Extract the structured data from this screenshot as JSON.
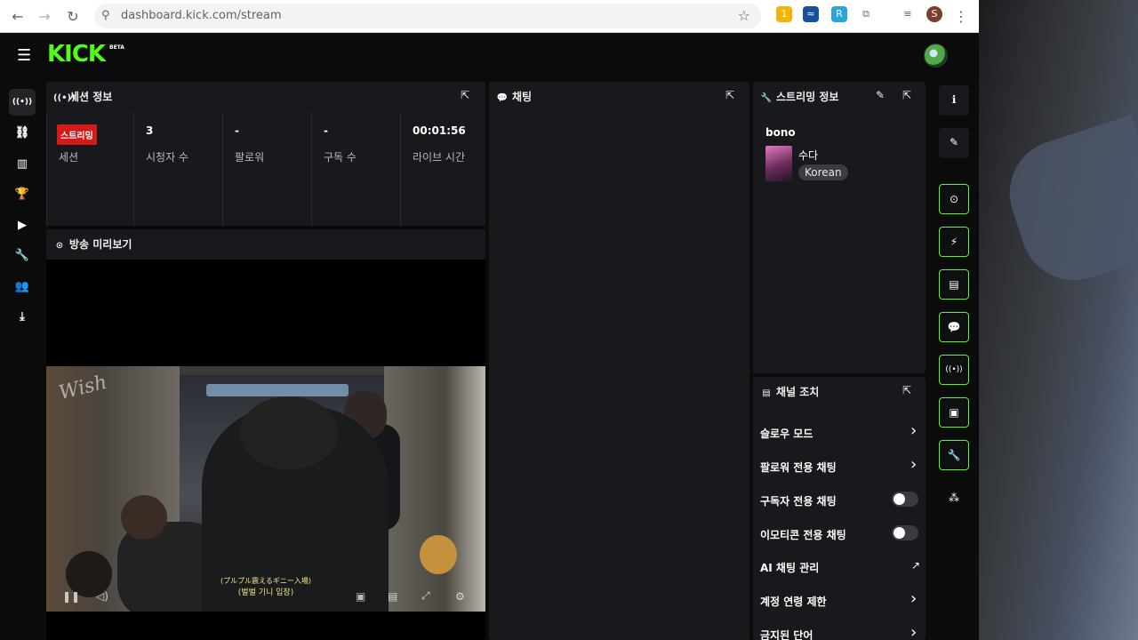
{
  "browser": {
    "url": "dashboard.kick.com/stream",
    "nav_back": "←",
    "nav_forward": "→",
    "reload": "↻",
    "site_icon": "⚲",
    "star": "☆",
    "menu": "⋮",
    "extensions": [
      "1",
      "≈",
      "R",
      "⧉",
      "≡"
    ],
    "profile_initial": "S"
  },
  "app": {
    "logo": "KICK",
    "logo_badge": "BETA",
    "menu_icon": "☰",
    "left_nav": [
      {
        "icon": "((•))",
        "name": "stream"
      },
      {
        "icon": "⛓",
        "name": "links"
      },
      {
        "icon": "▥",
        "name": "analytics"
      },
      {
        "icon": "🏆",
        "name": "achievements"
      },
      {
        "icon": "▶",
        "name": "videos"
      },
      {
        "icon": "🔧",
        "name": "tools"
      },
      {
        "icon": "👥",
        "name": "community"
      },
      {
        "icon": "⤓",
        "name": "upload"
      }
    ]
  },
  "session": {
    "title": "세션 정보",
    "title_icon": "((•))",
    "popout_icon": "⇱",
    "stats": [
      {
        "value": "스트리밍",
        "label": "세션",
        "badge": true
      },
      {
        "value": "3",
        "label": "시청자 수"
      },
      {
        "value": "-",
        "label": "팔로워"
      },
      {
        "value": "-",
        "label": "구독 수"
      },
      {
        "value": "00:01:56",
        "label": "라이브 시간"
      }
    ]
  },
  "preview": {
    "title": "방송 미리보기",
    "title_icon": "⊙",
    "watermark": "Wish",
    "subtitle_ja": "(プルプル震えるギニー入場)",
    "subtitle_ko": "(벌벌 기니 입장)",
    "controls": [
      "❚❚",
      "◁)",
      "▣",
      "▤",
      "⤢",
      "⚙"
    ]
  },
  "chat": {
    "title": "채팅",
    "title_icon": "💬",
    "popout_icon": "⇱"
  },
  "stream_info": {
    "title": "스트리밍 정보",
    "title_icon": "🔧",
    "edit_icon": "✎",
    "popout_icon": "⇱",
    "name": "bono",
    "category": "수다",
    "tag": "Korean"
  },
  "channel_actions": {
    "title": "채널 조치",
    "title_icon": "▤",
    "popout_icon": "⇱",
    "items": [
      {
        "label": "슬로우 모드",
        "control": "chevron",
        "glyph": "›"
      },
      {
        "label": "팔로워 전용 채팅",
        "control": "chevron",
        "glyph": "›"
      },
      {
        "label": "구독자 전용 채팅",
        "control": "toggle",
        "on": false
      },
      {
        "label": "이모티콘 전용 채팅",
        "control": "toggle",
        "on": false
      },
      {
        "label": "AI 채팅 관리",
        "control": "external",
        "glyph": "↗"
      },
      {
        "label": "계정 연령 제한",
        "control": "chevron",
        "glyph": "›"
      },
      {
        "label": "금지된 단어",
        "control": "chevron",
        "glyph": "›"
      }
    ]
  },
  "rail": [
    {
      "icon": "ℹ",
      "name": "info",
      "style": "plain"
    },
    {
      "icon": "✎",
      "name": "edit",
      "style": "plain"
    },
    {
      "icon": "⊙",
      "name": "preview",
      "style": "green"
    },
    {
      "icon": "⚡",
      "name": "quick-actions",
      "style": "green"
    },
    {
      "icon": "▤",
      "name": "notes",
      "style": "green"
    },
    {
      "icon": "💬",
      "name": "chat",
      "style": "green"
    },
    {
      "icon": "((•))",
      "name": "session",
      "style": "green"
    },
    {
      "icon": "▣",
      "name": "channel-actions",
      "style": "green"
    },
    {
      "icon": "🔧",
      "name": "stream-info",
      "style": "green"
    },
    {
      "icon": "⁂",
      "name": "more",
      "style": "plain"
    }
  ],
  "colors": {
    "accent": "#53fc18",
    "live": "#d41919",
    "panel": "#18191c",
    "background": "#0b0b0b"
  }
}
